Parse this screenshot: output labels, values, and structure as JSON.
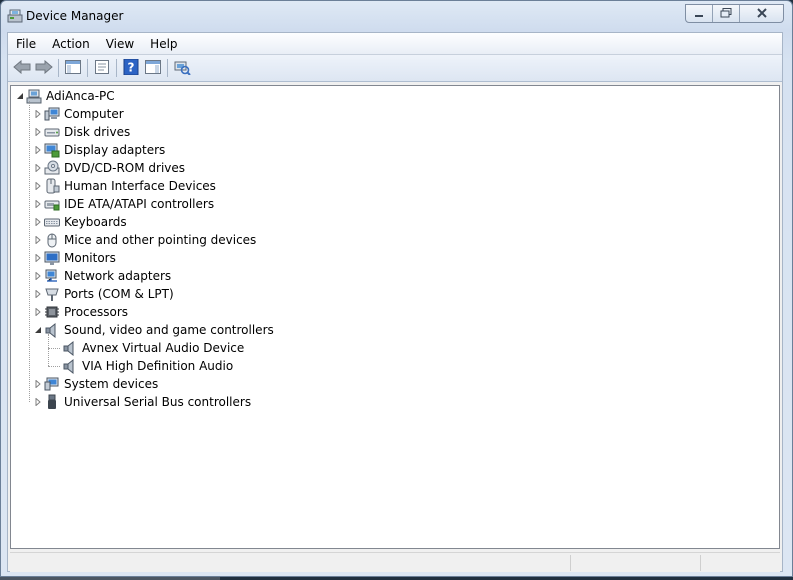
{
  "window": {
    "title": "Device Manager"
  },
  "menu": {
    "items": [
      "File",
      "Action",
      "View",
      "Help"
    ]
  },
  "toolbar": {
    "buttons": [
      "back-icon",
      "forward-icon",
      "show-hide-tree-icon",
      "properties-icon",
      "help-icon",
      "action-pane-icon",
      "scan-hardware-icon"
    ]
  },
  "tree": {
    "root": "AdiAnca-PC",
    "categories": [
      {
        "label": "Computer",
        "icon": "computer-icon",
        "expanded": false
      },
      {
        "label": "Disk drives",
        "icon": "disk-drive-icon",
        "expanded": false
      },
      {
        "label": "Display adapters",
        "icon": "display-adapter-icon",
        "expanded": false
      },
      {
        "label": "DVD/CD-ROM drives",
        "icon": "dvd-drive-icon",
        "expanded": false
      },
      {
        "label": "Human Interface Devices",
        "icon": "hid-icon",
        "expanded": false
      },
      {
        "label": "IDE ATA/ATAPI controllers",
        "icon": "ide-controller-icon",
        "expanded": false
      },
      {
        "label": "Keyboards",
        "icon": "keyboard-icon",
        "expanded": false
      },
      {
        "label": "Mice and other pointing devices",
        "icon": "mouse-icon",
        "expanded": false
      },
      {
        "label": "Monitors",
        "icon": "monitor-icon",
        "expanded": false
      },
      {
        "label": "Network adapters",
        "icon": "network-adapter-icon",
        "expanded": false
      },
      {
        "label": "Ports (COM & LPT)",
        "icon": "port-icon",
        "expanded": false
      },
      {
        "label": "Processors",
        "icon": "processor-icon",
        "expanded": false
      },
      {
        "label": "Sound, video and game controllers",
        "icon": "speaker-icon",
        "expanded": true,
        "children": [
          "Avnex Virtual Audio Device",
          "VIA High Definition Audio"
        ]
      },
      {
        "label": "System devices",
        "icon": "system-devices-icon",
        "expanded": false
      },
      {
        "label": "Universal Serial Bus controllers",
        "icon": "usb-icon",
        "expanded": false
      }
    ]
  },
  "colors": {
    "accent": "#1f5fbf",
    "frame": "#cfdcee"
  }
}
